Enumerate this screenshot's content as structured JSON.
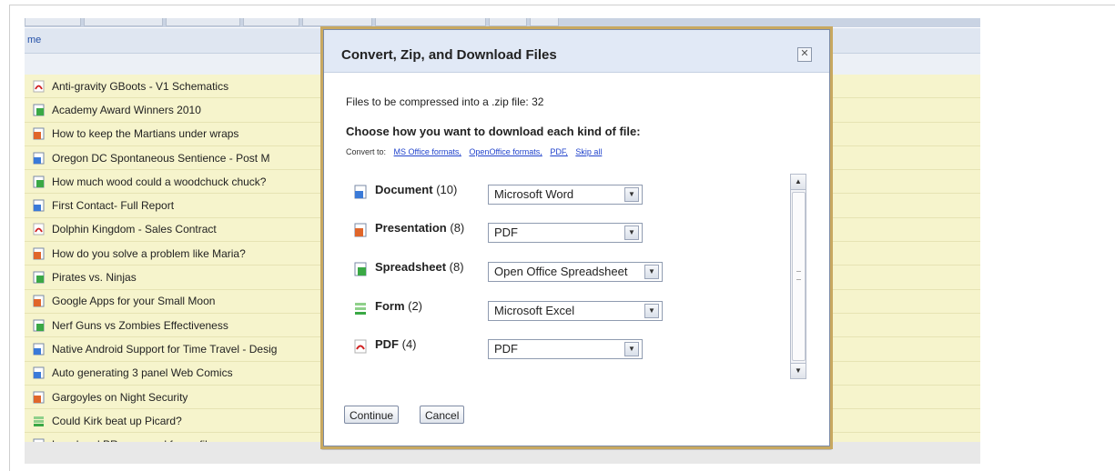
{
  "background": {
    "header_label": "me",
    "files": [
      {
        "icon": "pdf-icon",
        "name": "Anti-gravity GBoots - V1 Schematics"
      },
      {
        "icon": "spreadsheet-icon",
        "name": "Academy Award Winners 2010"
      },
      {
        "icon": "presentation-icon",
        "name": "How to keep the Martians under wraps"
      },
      {
        "icon": "document-icon",
        "name": "Oregon DC Spontaneous Sentience - Post M"
      },
      {
        "icon": "spreadsheet-icon",
        "name": "How much wood could a woodchuck chuck?"
      },
      {
        "icon": "document-icon",
        "name": "First Contact- Full Report"
      },
      {
        "icon": "pdf-icon",
        "name": "Dolphin Kingdom - Sales Contract"
      },
      {
        "icon": "presentation-icon",
        "name": "How do you solve a problem like Maria?"
      },
      {
        "icon": "spreadsheet-icon",
        "name": "Pirates vs. Ninjas"
      },
      {
        "icon": "presentation-icon",
        "name": "Google Apps for your Small Moon"
      },
      {
        "icon": "spreadsheet-icon",
        "name": "Nerf Guns vs Zombies Effectiveness"
      },
      {
        "icon": "document-icon",
        "name": "Native Android Support for Time Travel - Desig"
      },
      {
        "icon": "document-icon",
        "name": "Auto generating 3 panel Web Comics"
      },
      {
        "icon": "presentation-icon",
        "name": "Gargoyles on Night Security"
      },
      {
        "icon": "form-icon",
        "name": "Could Kirk beat up Picard?"
      },
      {
        "icon": "document-icon",
        "name": "Legal and PR approved funny file names"
      }
    ]
  },
  "dialog": {
    "title": "Convert, Zip, and Download Files",
    "close_icon": "close-icon",
    "count_text": "Files to be compressed into a .zip file: 32",
    "choose_text": "Choose how you want to download each kind of file:",
    "convert_to_label": "Convert to:",
    "convert_links": [
      "MS Office formats,",
      "OpenOffice formats,",
      "PDF,",
      "Skip all"
    ],
    "file_types": [
      {
        "icon": "document-icon",
        "name": "Document",
        "count": "(10)",
        "selected": "Microsoft Word"
      },
      {
        "icon": "presentation-icon",
        "name": "Presentation",
        "count": "(8)",
        "selected": "PDF"
      },
      {
        "icon": "spreadsheet-icon",
        "name": "Spreadsheet",
        "count": "(8)",
        "selected": "Open Office Spreadsheet"
      },
      {
        "icon": "form-icon",
        "name": "Form",
        "count": "(2)",
        "selected": "Microsoft Excel"
      },
      {
        "icon": "pdf-icon",
        "name": "PDF",
        "count": "(4)",
        "selected": "PDF"
      }
    ],
    "continue_label": "Continue",
    "cancel_label": "Cancel"
  },
  "colors": {
    "row_yellow": "#f6f4cc",
    "header_blue": "#e1e9f6",
    "link_blue": "#2244cc",
    "dialog_border_gold": "#c8a860"
  }
}
